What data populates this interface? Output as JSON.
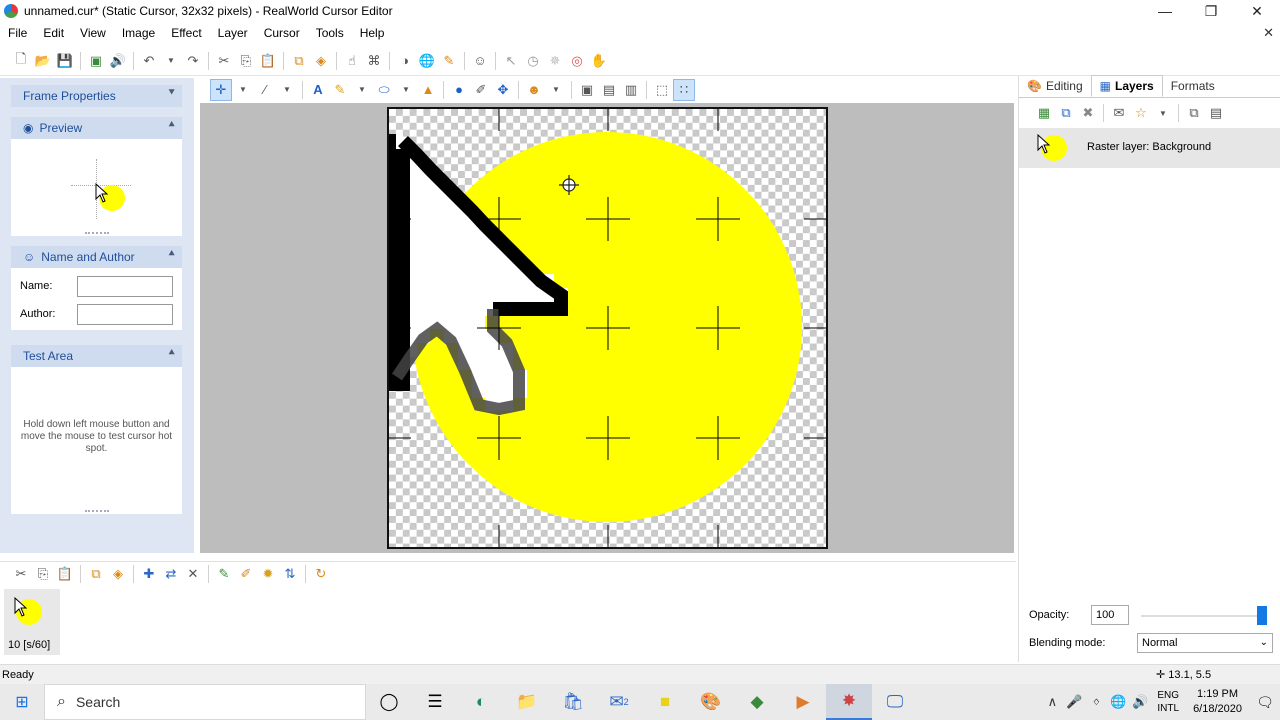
{
  "window": {
    "title": "unnamed.cur* (Static Cursor, 32x32 pixels) - RealWorld Cursor Editor",
    "minimize_icon": "minimize-icon",
    "maximize_icon": "restore-icon",
    "close_icon": "close-icon"
  },
  "menubar": {
    "items": [
      "File",
      "Edit",
      "View",
      "Image",
      "Effect",
      "Layer",
      "Cursor",
      "Tools",
      "Help"
    ]
  },
  "left_panel": {
    "frame_properties": "Frame Properties",
    "preview": "Preview",
    "name_and_author": "Name and Author",
    "name_label": "Name:",
    "author_label": "Author:",
    "name_value": "",
    "author_value": "",
    "test_area": "Test Area",
    "test_area_text": "Hold down left mouse button and move the mouse to test cursor hot spot."
  },
  "right_panel": {
    "tabs": [
      "Editing",
      "Layers",
      "Formats"
    ],
    "active_tab": "Layers",
    "layer_name": "Raster layer: Background",
    "opacity_label": "Opacity:",
    "opacity_value": "100",
    "opacity_fraction": 1.0,
    "blending_label": "Blending mode:",
    "blending_value": "Normal"
  },
  "frames": {
    "frame_label": "10 [s/60]"
  },
  "status": {
    "text": "Ready",
    "coords": "13.1, 5.5"
  },
  "taskbar": {
    "search_placeholder": "Search",
    "lang_line1": "ENG",
    "lang_line2": "INTL",
    "time": "1:19 PM",
    "date": "6/18/2020",
    "mail_badge": "2"
  },
  "colors": {
    "highlight_yellow": "#ffff00",
    "accent_blue": "#1479e3",
    "panel_bg": "#dfe6f3",
    "panel_head": "#cfdcef"
  }
}
